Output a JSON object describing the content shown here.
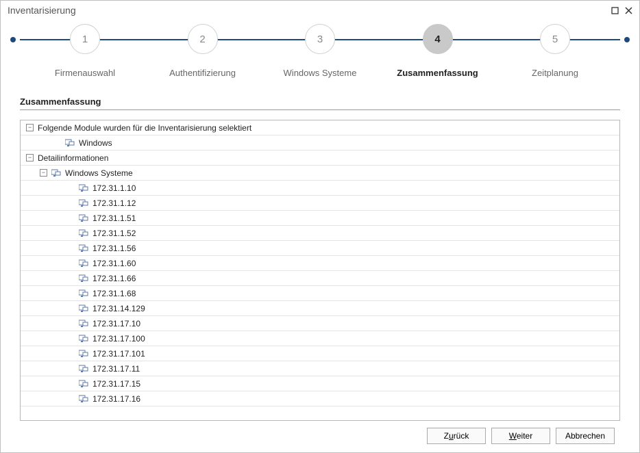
{
  "window": {
    "title": "Inventarisierung"
  },
  "stepper": {
    "active_index": 3,
    "steps": [
      {
        "num": "1",
        "label": "Firmenauswahl"
      },
      {
        "num": "2",
        "label": "Authentifizierung"
      },
      {
        "num": "3",
        "label": "Windows Systeme"
      },
      {
        "num": "4",
        "label": "Zusammenfassung"
      },
      {
        "num": "5",
        "label": "Zeitplanung"
      }
    ]
  },
  "section": {
    "title": "Zusammenfassung"
  },
  "tree": {
    "nodes": [
      {
        "depth": 0,
        "expander": "minus",
        "icon": "none",
        "label": "Folgende Module wurden für die Inventarisierung selektiert"
      },
      {
        "depth": 2,
        "expander": "none",
        "icon": "node",
        "label": "Windows"
      },
      {
        "depth": 0,
        "expander": "minus",
        "icon": "none",
        "label": "Detailinformationen"
      },
      {
        "depth": 1,
        "expander": "minus",
        "icon": "node",
        "label": "Windows Systeme"
      },
      {
        "depth": 3,
        "expander": "none",
        "icon": "node",
        "label": "172.31.1.10"
      },
      {
        "depth": 3,
        "expander": "none",
        "icon": "node",
        "label": "172.31.1.12"
      },
      {
        "depth": 3,
        "expander": "none",
        "icon": "node",
        "label": "172.31.1.51"
      },
      {
        "depth": 3,
        "expander": "none",
        "icon": "node",
        "label": "172.31.1.52"
      },
      {
        "depth": 3,
        "expander": "none",
        "icon": "node",
        "label": "172.31.1.56"
      },
      {
        "depth": 3,
        "expander": "none",
        "icon": "node",
        "label": "172.31.1.60"
      },
      {
        "depth": 3,
        "expander": "none",
        "icon": "node",
        "label": "172.31.1.66"
      },
      {
        "depth": 3,
        "expander": "none",
        "icon": "node",
        "label": "172.31.1.68"
      },
      {
        "depth": 3,
        "expander": "none",
        "icon": "node",
        "label": "172.31.14.129"
      },
      {
        "depth": 3,
        "expander": "none",
        "icon": "node",
        "label": "172.31.17.10"
      },
      {
        "depth": 3,
        "expander": "none",
        "icon": "node",
        "label": "172.31.17.100"
      },
      {
        "depth": 3,
        "expander": "none",
        "icon": "node",
        "label": "172.31.17.101"
      },
      {
        "depth": 3,
        "expander": "none",
        "icon": "node",
        "label": "172.31.17.11"
      },
      {
        "depth": 3,
        "expander": "none",
        "icon": "node",
        "label": "172.31.17.15"
      },
      {
        "depth": 3,
        "expander": "none",
        "icon": "node",
        "label": "172.31.17.16"
      }
    ]
  },
  "buttons": {
    "back_prefix": "Z",
    "back_mnemonic": "u",
    "back_suffix": "rück",
    "next_prefix": "",
    "next_mnemonic": "W",
    "next_suffix": "eiter",
    "cancel": "Abbrechen"
  }
}
